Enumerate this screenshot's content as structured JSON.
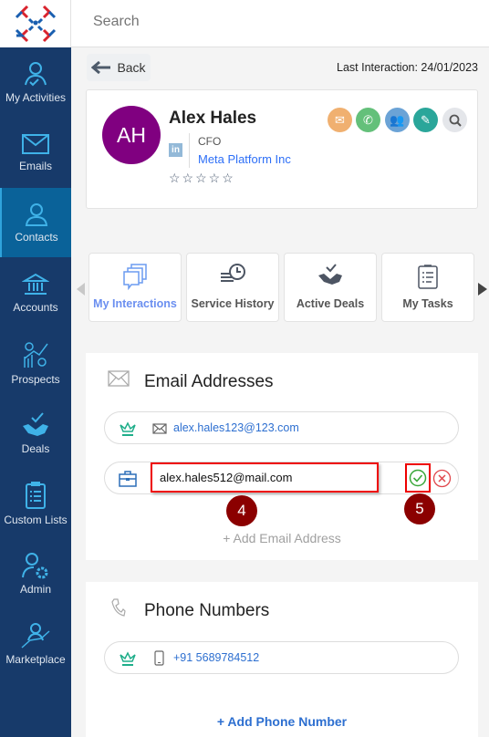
{
  "header": {
    "search_placeholder": "Search"
  },
  "sidebar": {
    "items": [
      {
        "label": "My Activities",
        "icon": "user-check-icon"
      },
      {
        "label": "Emails",
        "icon": "envelope-icon"
      },
      {
        "label": "Contacts",
        "icon": "user-icon",
        "active": true
      },
      {
        "label": "Accounts",
        "icon": "bank-icon"
      },
      {
        "label": "Prospects",
        "icon": "chart-gear-icon"
      },
      {
        "label": "Deals",
        "icon": "handshake-icon"
      },
      {
        "label": "Custom Lists",
        "icon": "clipboard-list-icon"
      },
      {
        "label": "Admin",
        "icon": "user-gear-icon"
      },
      {
        "label": "Marketplace",
        "icon": "marketplace-icon"
      }
    ]
  },
  "toolbar": {
    "back_label": "Back",
    "last_interaction": "Last Interaction: 24/01/2023"
  },
  "contact": {
    "initials": "AH",
    "name": "Alex Hales",
    "title": "CFO",
    "company": "Meta Platform Inc",
    "linkedin": "in",
    "rating": 0,
    "max_rating": 5,
    "avatar_color": "#800080"
  },
  "actions": [
    {
      "name": "email",
      "color": "#f0b070"
    },
    {
      "name": "call",
      "color": "#64c07a"
    },
    {
      "name": "meeting",
      "color": "#6ba3d6"
    },
    {
      "name": "note",
      "color": "#2aa69a"
    },
    {
      "name": "search",
      "color": "#e4e6ea"
    }
  ],
  "tabs": [
    {
      "label": "My Interactions",
      "selected": true
    },
    {
      "label": "Service History"
    },
    {
      "label": "Active Deals"
    },
    {
      "label": "My Tasks"
    }
  ],
  "emails": {
    "title": "Email Addresses",
    "primary": "alex.hales123@123.com",
    "edit_value": "alex.hales512@mail.com",
    "add_label": "+ Add Email Address"
  },
  "phones": {
    "title": "Phone Numbers",
    "primary": "+91 5689784512",
    "add_label": "+ Add Phone Number"
  },
  "annotations": {
    "step4": "4",
    "step5": "5"
  }
}
